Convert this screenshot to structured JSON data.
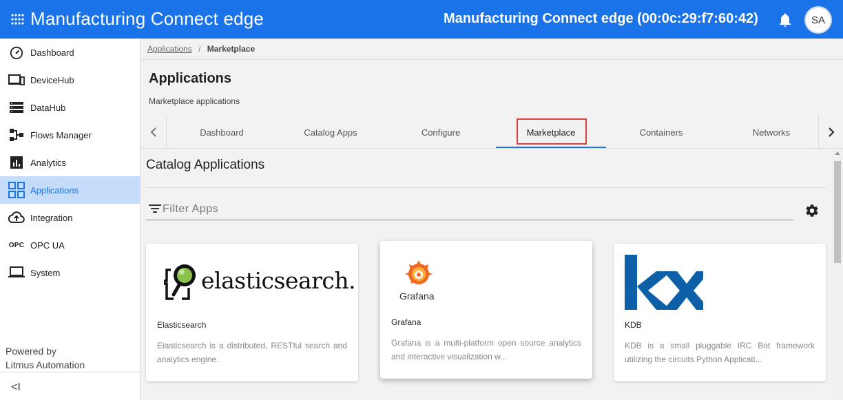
{
  "header": {
    "app_title": "Manufacturing Connect edge",
    "device_title": "Manufacturing Connect edge (00:0c:29:f7:60:42)",
    "avatar_initials": "SA",
    "brand_color": "#1a73e8"
  },
  "sidebar": {
    "items": [
      {
        "label": "Dashboard",
        "icon": "speedometer-icon"
      },
      {
        "label": "DeviceHub",
        "icon": "devices-icon"
      },
      {
        "label": "DataHub",
        "icon": "storage-icon"
      },
      {
        "label": "Flows Manager",
        "icon": "flows-icon"
      },
      {
        "label": "Analytics",
        "icon": "analytics-icon"
      },
      {
        "label": "Applications",
        "icon": "grid-icon",
        "active": true
      },
      {
        "label": "Integration",
        "icon": "cloud-upload-icon"
      },
      {
        "label": "OPC UA",
        "icon": "opc-icon",
        "icon_text": "OPC"
      },
      {
        "label": "System",
        "icon": "laptop-icon"
      }
    ],
    "powered_by_line1": "Powered by",
    "powered_by_line2": "Litmus Automation",
    "collapse_glyph": "<I"
  },
  "breadcrumb": {
    "parent": "Applications",
    "separator": "/",
    "current": "Marketplace"
  },
  "page": {
    "title": "Applications",
    "subtitle": "Marketplace applications"
  },
  "tabs": [
    {
      "label": "Dashboard"
    },
    {
      "label": "Catalog Apps"
    },
    {
      "label": "Configure"
    },
    {
      "label": "Marketplace",
      "active": true
    },
    {
      "label": "Containers"
    },
    {
      "label": "Networks"
    }
  ],
  "catalog": {
    "title": "Catalog Applications",
    "filter_placeholder": "Filter Apps",
    "cards": [
      {
        "name": "Elasticsearch",
        "logo_text": "elasticsearch.",
        "description": "Elasticsearch is a distributed, RESTful search and analytics engine."
      },
      {
        "name": "Grafana",
        "logo_text": "Grafana",
        "description": "Grafana is a multi-platform open source analytics and interactive visualization w..."
      },
      {
        "name": "KDB",
        "logo_text": "kx",
        "description": "KDB is a small pluggable IRC Bot framework utilizing the circuits Python Applicati..."
      }
    ]
  },
  "colors": {
    "active_nav_bg": "#c5dcfb",
    "tab_highlight": "#e04040",
    "kx_blue": "#0d5fa8",
    "grafana_orange": "#f26a21"
  }
}
